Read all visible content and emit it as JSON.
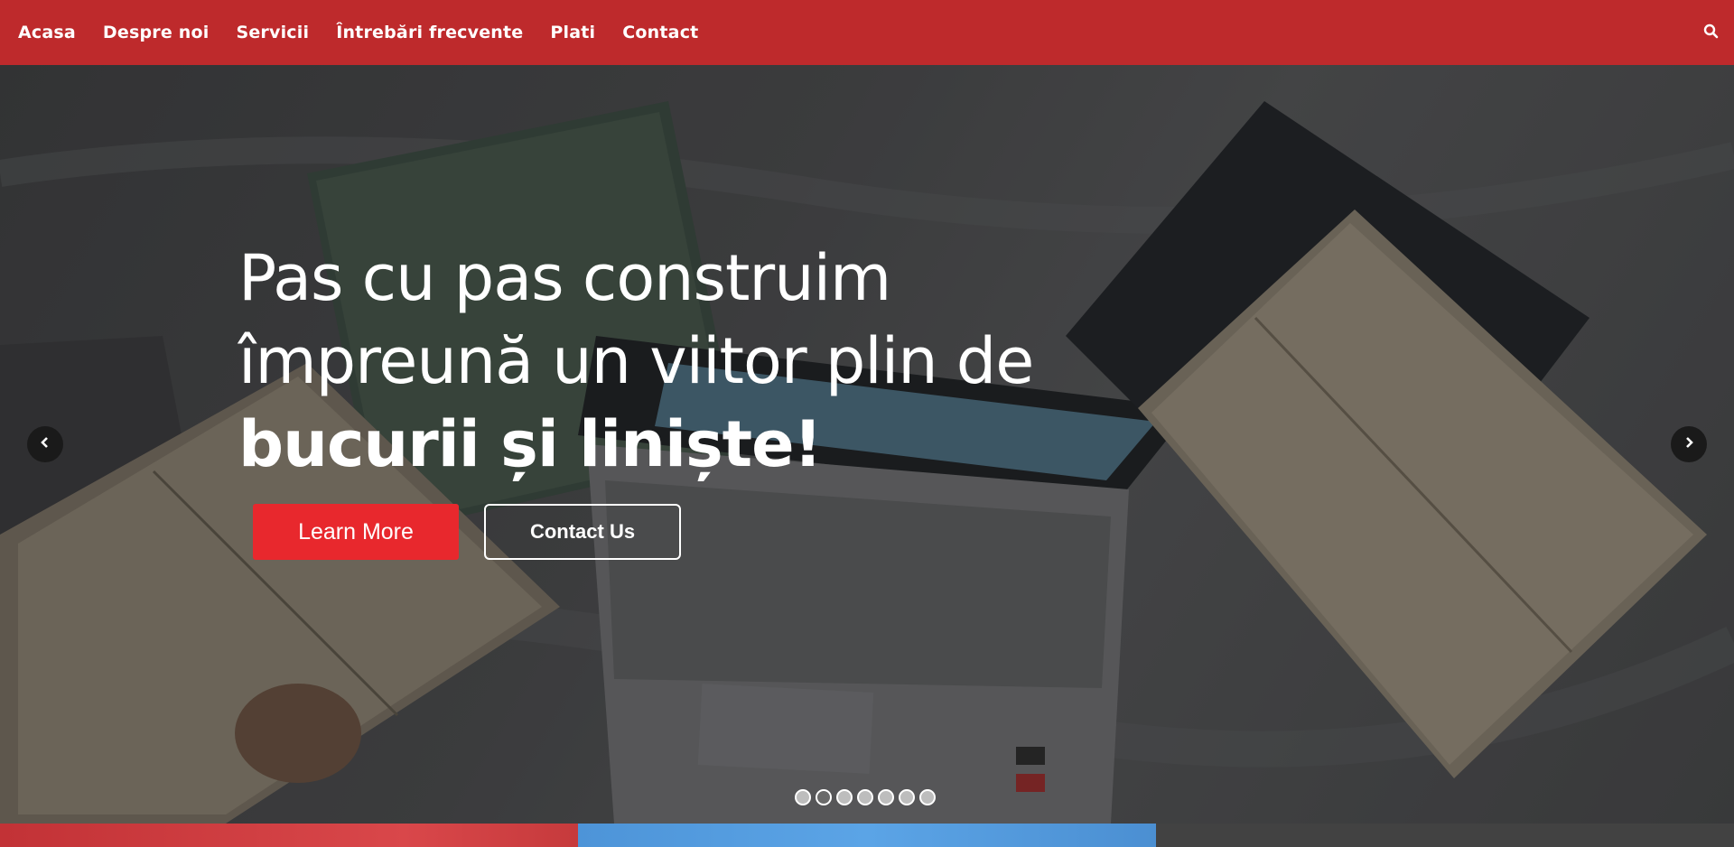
{
  "nav": {
    "items": [
      {
        "label": "Acasa"
      },
      {
        "label": "Despre noi"
      },
      {
        "label": "Servicii"
      },
      {
        "label": "Întrebări frecvente"
      },
      {
        "label": "Plati"
      },
      {
        "label": "Contact"
      }
    ],
    "search_icon": "search-icon"
  },
  "hero": {
    "line1": "Pas cu pas construim",
    "line2": "împreună un viitor plin de",
    "line3": "bucurii și liniște!",
    "learn_more": "Learn More",
    "contact_us": "Contact Us",
    "prev_icon": "chevron-left-icon",
    "next_icon": "chevron-right-icon",
    "slide_count": 7,
    "active_slide": 2
  },
  "colors": {
    "nav_bg": "#be2a2c",
    "primary_button": "#e8282d",
    "strip_red": "#c23236",
    "strip_blue": "#5ba4e6",
    "strip_dark": "#424242"
  }
}
